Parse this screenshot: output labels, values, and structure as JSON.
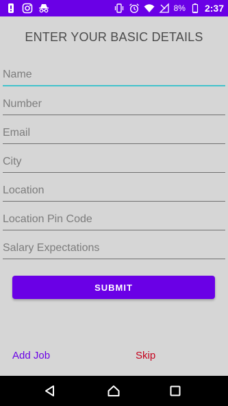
{
  "status_bar": {
    "battery_percent": "8%",
    "time": "2:37",
    "icons": [
      "notification-icon",
      "instagram-icon",
      "incognito-icon",
      "vibrate-icon",
      "alarm-icon",
      "wifi-icon",
      "signal-icon",
      "battery-icon"
    ]
  },
  "form": {
    "title": "ENTER YOUR BASIC DETAILS",
    "fields": [
      {
        "placeholder": "Name",
        "value": ""
      },
      {
        "placeholder": "Number",
        "value": ""
      },
      {
        "placeholder": "Email",
        "value": ""
      },
      {
        "placeholder": "City",
        "value": ""
      },
      {
        "placeholder": "Location",
        "value": ""
      },
      {
        "placeholder": "Location Pin Code",
        "value": ""
      },
      {
        "placeholder": "Salary Expectations",
        "value": ""
      }
    ],
    "submit_label": "SUBMIT"
  },
  "links": {
    "add_job": "Add Job",
    "skip": "Skip"
  },
  "colors": {
    "primary": "#6a00e6",
    "accent_underline": "#41c3cc",
    "skip": "#c4001c",
    "background": "#d6d6d6"
  },
  "nav": {
    "icons": [
      "back-icon",
      "home-icon",
      "recent-apps-icon"
    ]
  }
}
